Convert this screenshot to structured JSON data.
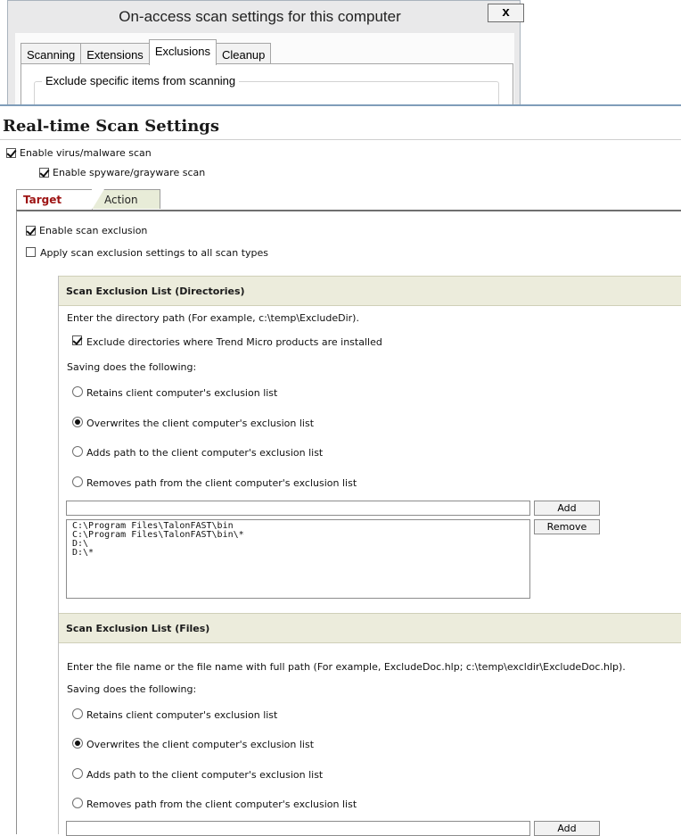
{
  "dialog": {
    "title": "On-access scan settings for this computer",
    "close_label": "x",
    "tabs": [
      "Scanning",
      "Extensions",
      "Exclusions",
      "Cleanup"
    ],
    "active_tab": "Exclusions",
    "group_label": "Exclude specific items from scanning"
  },
  "page": {
    "title": "Real-time Scan Settings",
    "enable_virus": {
      "label": "Enable virus/malware scan",
      "checked": true
    },
    "enable_spyware": {
      "label": "Enable spyware/grayware scan",
      "checked": true
    },
    "tabs": [
      {
        "label": "Target",
        "active": true
      },
      {
        "label": "Action",
        "active": false
      }
    ],
    "enable_exclusion": {
      "label": "Enable scan exclusion",
      "checked": true
    },
    "apply_all": {
      "label": "Apply scan exclusion settings to all scan types",
      "checked": false
    }
  },
  "directories": {
    "header": "Scan Exclusion List (Directories)",
    "hint": "Enter the directory path (For example, c:\\temp\\ExcludeDir).",
    "exclude_trend": {
      "label": "Exclude directories where Trend Micro products are installed",
      "checked": true
    },
    "saving_label": "Saving does the following:",
    "options": [
      {
        "label": "Retains client computer's exclusion list",
        "selected": false
      },
      {
        "label": "Overwrites the client computer's exclusion list",
        "selected": true
      },
      {
        "label": "Adds path to the client computer's exclusion list",
        "selected": false
      },
      {
        "label": "Removes path from the client computer's exclusion list",
        "selected": false
      }
    ],
    "input_value": "",
    "add_label": "Add",
    "remove_label": "Remove",
    "items": [
      "C:\\Program Files\\TalonFAST\\bin",
      "C:\\Program Files\\TalonFAST\\bin\\*",
      "D:\\",
      "D:\\*"
    ]
  },
  "files": {
    "header": "Scan Exclusion List (Files)",
    "hint": "Enter the file name or the file name with full path (For example, ExcludeDoc.hlp; c:\\temp\\excldir\\ExcludeDoc.hlp).",
    "saving_label": "Saving does the following:",
    "options": [
      {
        "label": "Retains client computer's exclusion list",
        "selected": false
      },
      {
        "label": "Overwrites the client computer's exclusion list",
        "selected": true
      },
      {
        "label": "Adds path to the client computer's exclusion list",
        "selected": false
      },
      {
        "label": "Removes path from the client computer's exclusion list",
        "selected": false
      }
    ],
    "input_value": "",
    "add_label": "Add"
  }
}
